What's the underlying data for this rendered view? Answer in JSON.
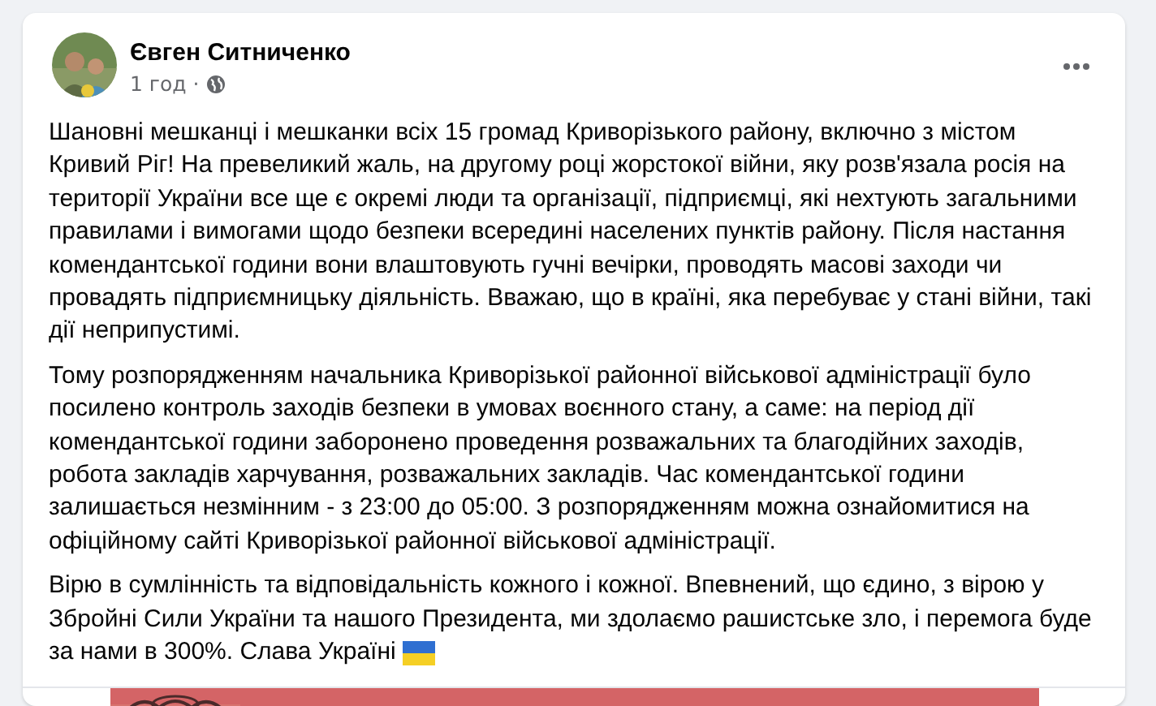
{
  "post": {
    "author": "Євген Ситниченко",
    "time": "1 год",
    "separator": "·",
    "paragraphs": [
      "Шановні мешканці і мешканки всіх 15 громад Криворізького району, включно з містом Кривий Ріг! На превеликий жаль, на другому році жорстокої війни, яку розв'язала росія на території України все ще є окремі люди та організації, підприємці, які нехтують загальними правилами і вимогами щодо безпеки всередині населених пунктів району. Після настання комендантської години вони влаштовують гучні вечірки, проводять масові заходи чи провадять підприємницьку діяльність. Вважаю, що в країні, яка перебуває у стані війни, такі дії неприпустимі.",
      "Тому розпорядженням начальника Криворізької районної військової адміністрації було посилено контроль заходів безпеки в умовах воєнного стану, а саме: на період дії комендантської години заборонено проведення розважальних та благодійних заходів, робота закладів харчування, розважальних закладів. Час комендантської години залишається незмінним - з 23:00 до 05:00. З розпорядженням можна ознайомитися на офіційному сайті Криворізької районної військової адміністрації.",
      {
        "kind": "closing",
        "lines": [
          "Вірю в сумлінність та відповідальність кожного і кожної. Впевнений, що єдино, з вірою у Збройні Сили України та нашого Президента, ми здолаємо рашистське зло, і перемога буде",
          "за нами в 300%. Слава Україні"
        ]
      }
    ]
  }
}
